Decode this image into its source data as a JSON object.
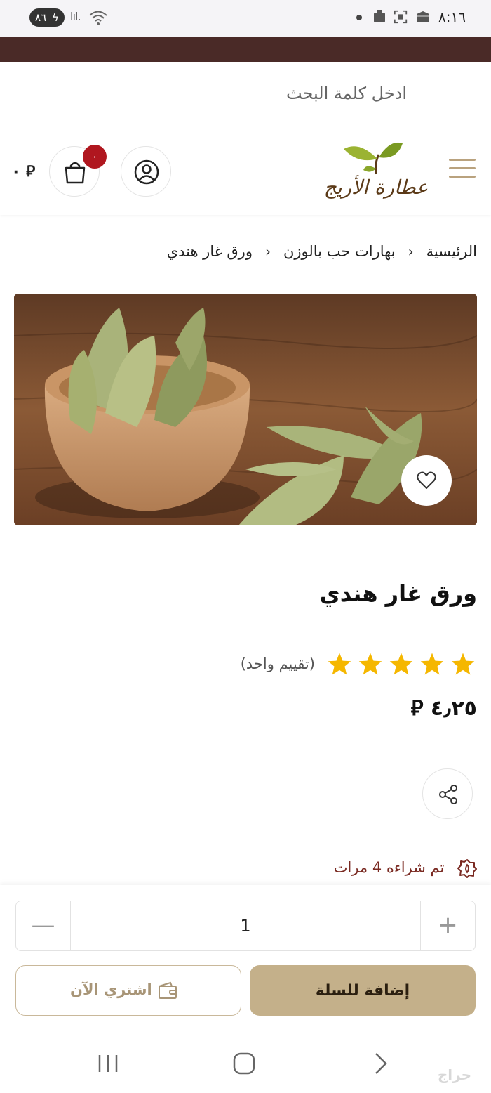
{
  "status_bar": {
    "time": "٨:١٦",
    "battery": "٨٦"
  },
  "search": {
    "placeholder": "ادخل كلمة البحث"
  },
  "header": {
    "logo_text": "عطارة الأريج",
    "cart_badge": "٠",
    "cart_total": "٠ ⃁"
  },
  "breadcrumb": {
    "items": [
      "الرئيسية",
      "بهارات حب بالوزن",
      "ورق غار هندي"
    ]
  },
  "product": {
    "title": "ورق غار هندي",
    "rating_stars": 5,
    "rating_text": "(تقييم واحد)",
    "price": "٤٫٢٥ ⃁",
    "purchase_count_text": "تم شراءه 4 مرات"
  },
  "quantity": {
    "value": "1"
  },
  "actions": {
    "add_to_cart": "إضافة للسلة",
    "buy_now": "اشتري الآن"
  },
  "colors": {
    "brand_strip": "#4a2a27",
    "accent": "#c4b08a",
    "badge": "#b0171f",
    "star": "#f5b700"
  },
  "watermark": "حراج"
}
